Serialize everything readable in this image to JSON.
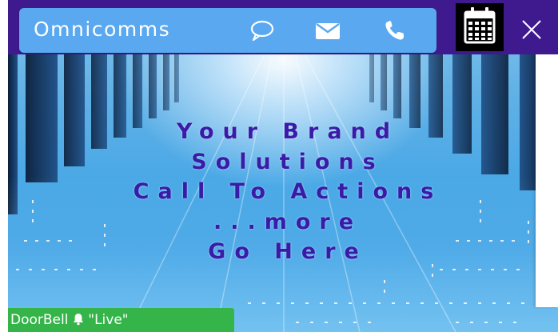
{
  "header": {
    "brand": "Omnicomms",
    "icons": {
      "chat": "chat-bubble-icon",
      "email": "envelope-icon",
      "phone": "phone-icon",
      "calendar": "calendar-icon",
      "close": "close-icon"
    }
  },
  "hero": {
    "lines": [
      "Your Brand",
      "Solutions",
      "Call To Actions",
      "...more",
      "Go Here"
    ]
  },
  "doorbell": {
    "label": "DoorBell",
    "icon": "bell-icon",
    "status": "\"Live\""
  },
  "colors": {
    "header_strip": "#3f1a8e",
    "brand_bar": "#5aa8ef",
    "hero_text": "#3a1ba8",
    "doorbell_bg": "#35b449"
  }
}
